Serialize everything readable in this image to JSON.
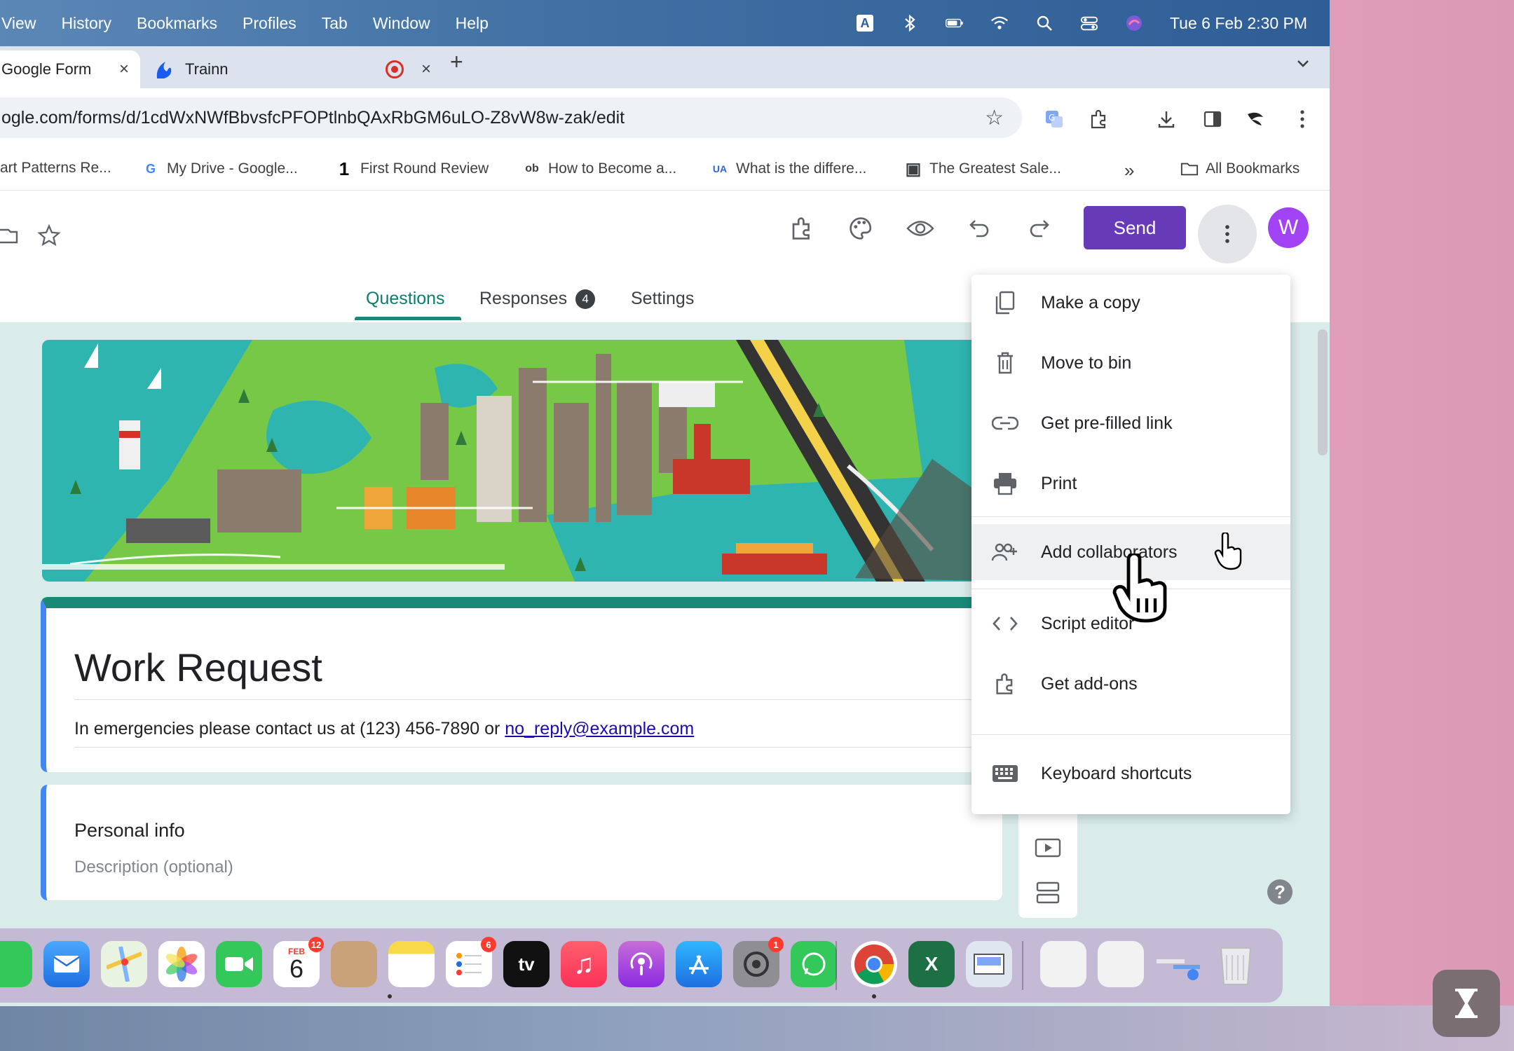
{
  "menubar": {
    "items": [
      "View",
      "History",
      "Bookmarks",
      "Profiles",
      "Tab",
      "Window",
      "Help"
    ],
    "clock": "Tue 6 Feb  2:30 PM",
    "input_source": "A"
  },
  "tabs": [
    {
      "title": "Google Form",
      "close": "×"
    },
    {
      "title": "Trainn",
      "close": "×"
    }
  ],
  "new_tab": "+",
  "address": {
    "url": "ogle.com/forms/d/1cdWxNWfBbvsfcPFOPtlnbQAxRbGM6uLO-Z8vW8w-zak/edit"
  },
  "bookmarks": {
    "items": [
      {
        "label": "art Patterns Re...",
        "icon": ""
      },
      {
        "label": "My Drive - Google...",
        "icon": "G"
      },
      {
        "label": "First Round Review",
        "icon": "1"
      },
      {
        "label": "How to Become a...",
        "icon": "ob"
      },
      {
        "label": "What is the differe...",
        "icon": "UA"
      },
      {
        "label": "The Greatest Sale...",
        "icon": "▣"
      }
    ],
    "overflow": "»",
    "all": "All Bookmarks"
  },
  "form_header": {
    "send_label": "Send",
    "avatar_letter": "W",
    "tabs": {
      "questions": "Questions",
      "responses": "Responses",
      "responses_count": "4",
      "settings": "Settings"
    }
  },
  "form": {
    "title": "Work Request",
    "desc_prefix": "In emergencies please contact us at (123) 456-7890 or ",
    "desc_link": "no_reply@example.com",
    "section_title": "Personal info",
    "section_desc": "Description (optional)"
  },
  "menu": {
    "items": [
      {
        "label": "Make a copy",
        "icon": "copy-icon"
      },
      {
        "label": "Move to bin",
        "icon": "trash-icon"
      },
      {
        "label": "Get pre-filled link",
        "icon": "link-icon"
      },
      {
        "label": "Print",
        "icon": "print-icon"
      },
      {
        "label": "Add collaborators",
        "icon": "add-people-icon"
      },
      {
        "label": "Script editor",
        "icon": "code-icon"
      },
      {
        "label": "Get add-ons",
        "icon": "addons-icon"
      },
      {
        "label": "Keyboard shortcuts",
        "icon": "keyboard-icon"
      }
    ]
  },
  "dock": {
    "calendar_month": "FEB",
    "calendar_day": "6",
    "calendar_badge": "12",
    "reminders_badge": "6",
    "settings_badge": "1",
    "tv_label": "tv"
  },
  "colors": {
    "send": "#673ab7",
    "accent_green": "#1a8a76",
    "accent_blue": "#4285f4",
    "avatar": "#a142f4"
  }
}
